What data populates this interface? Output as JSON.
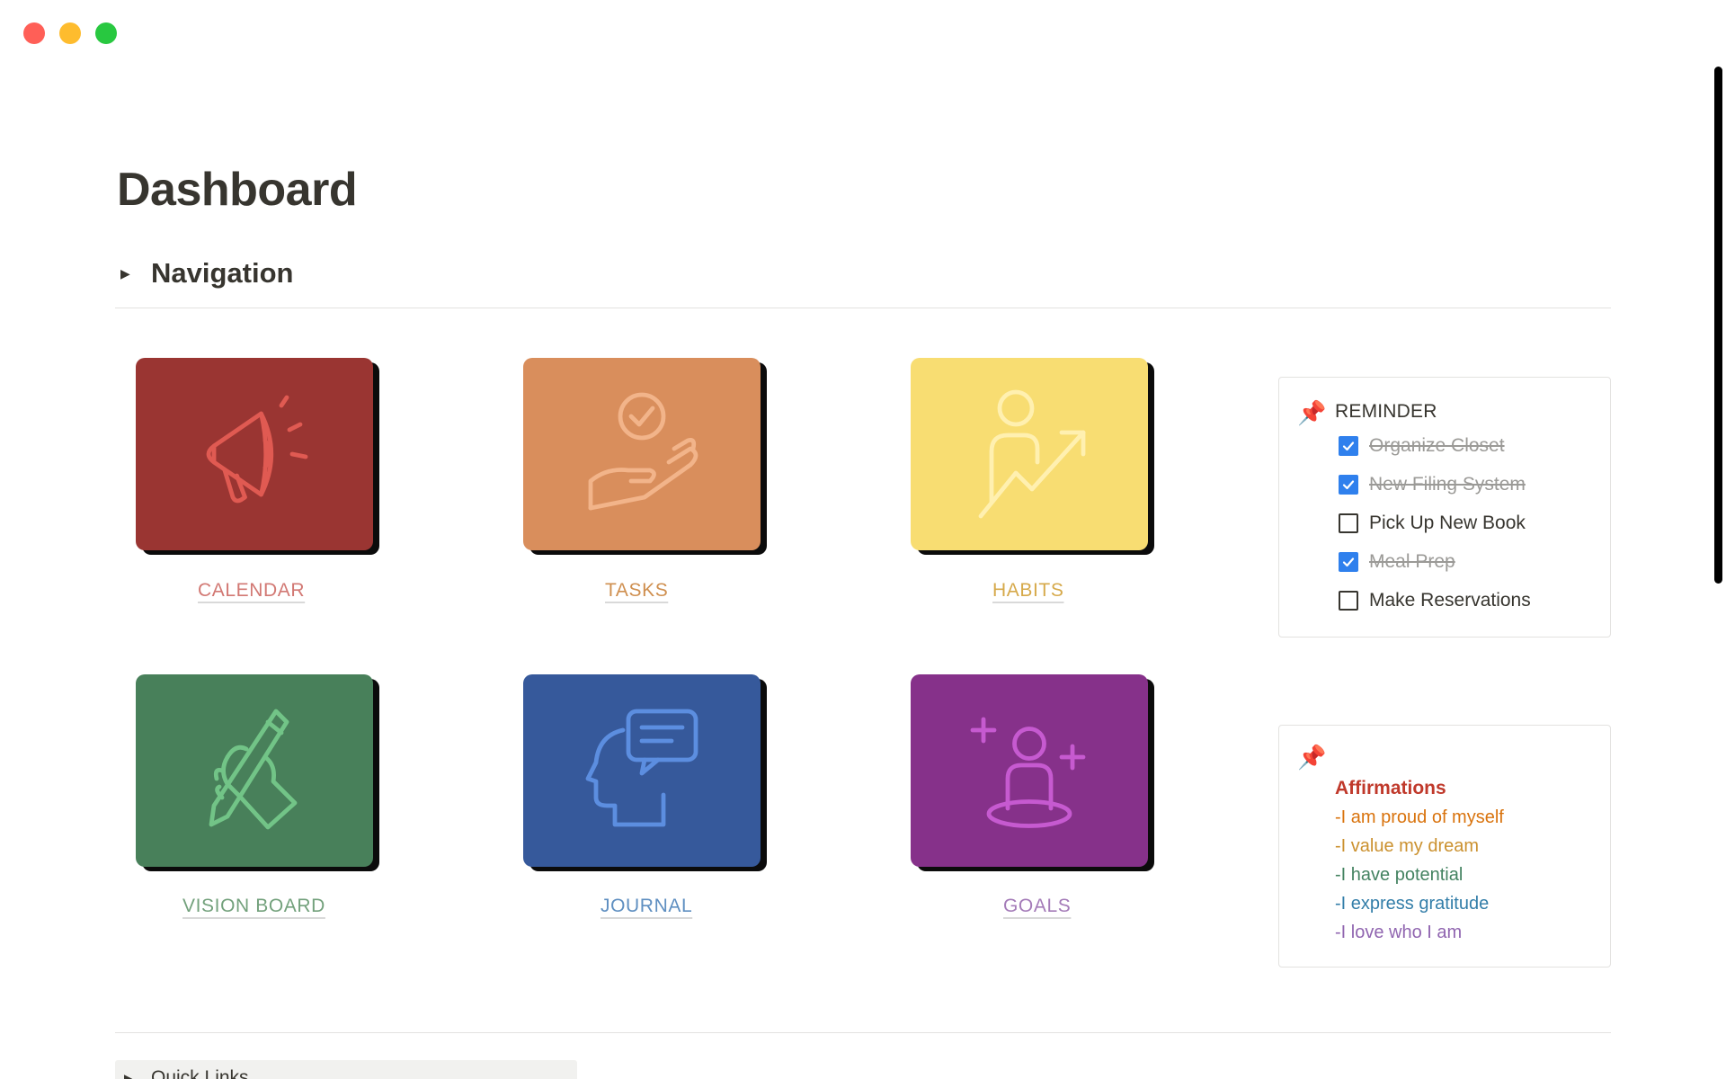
{
  "window": {
    "controls": [
      "close",
      "minimize",
      "zoom"
    ]
  },
  "page": {
    "title": "Dashboard"
  },
  "navigation": {
    "toggle_title": "Navigation",
    "tiles": [
      {
        "label": "CALENDAR",
        "icon": "megaphone-icon",
        "bg": "#9a3532",
        "icon_color": "#e05a52",
        "label_color": "#d27873"
      },
      {
        "label": "TASKS",
        "icon": "hand-check-icon",
        "bg": "#d98e5c",
        "icon_color": "#f2b48a",
        "label_color": "#cf8f4f"
      },
      {
        "label": "HABITS",
        "icon": "person-growth-icon",
        "bg": "#f8dd72",
        "icon_color": "#fff0b0",
        "label_color": "#d6a94a"
      },
      {
        "label": "VISION BOARD",
        "icon": "hand-pencil-icon",
        "bg": "#48805a",
        "icon_color": "#72c487",
        "label_color": "#73a17c"
      },
      {
        "label": "JOURNAL",
        "icon": "head-chat-icon",
        "bg": "#36599b",
        "icon_color": "#5c8ee0",
        "label_color": "#5f8fc1"
      },
      {
        "label": "GOALS",
        "icon": "person-stars-icon",
        "bg": "#86318a",
        "icon_color": "#c65ad0",
        "label_color": "#a47bb8"
      }
    ]
  },
  "reminder": {
    "pin_icon": "pushpin-icon",
    "title": "REMINDER",
    "items": [
      {
        "text": "Organize Closet",
        "checked": true
      },
      {
        "text": "New Filing System",
        "checked": true
      },
      {
        "text": "Pick Up New Book",
        "checked": false
      },
      {
        "text": "Meal Prep",
        "checked": true
      },
      {
        "text": "Make Reservations",
        "checked": false
      }
    ]
  },
  "affirmations": {
    "pin_icon": "pushpin-icon",
    "title": "Affirmations",
    "title_color": "#c0392b",
    "lines": [
      {
        "text": "-I am proud of myself",
        "color": "#d9730d"
      },
      {
        "text": "-I value my dream",
        "color": "#cb912f"
      },
      {
        "text": "-I have potential",
        "color": "#448361"
      },
      {
        "text": "-I express gratitude",
        "color": "#337ea9"
      },
      {
        "text": "-I love who I am",
        "color": "#9065b0"
      }
    ]
  },
  "quick_links": {
    "label": "Quick Links"
  }
}
